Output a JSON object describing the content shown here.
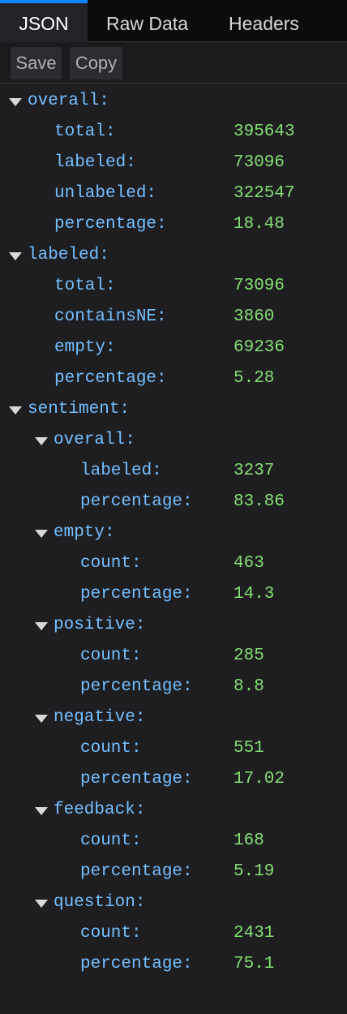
{
  "tabs": [
    {
      "label": "JSON",
      "active": true
    },
    {
      "label": "Raw Data",
      "active": false
    },
    {
      "label": "Headers",
      "active": false
    }
  ],
  "toolbar": {
    "save_label": "Save",
    "copy_label": "Copy"
  },
  "colors": {
    "key": "#75bfff",
    "value": "#86de74",
    "accent": "#0a84ff",
    "background": "#1e1e21"
  },
  "tree": {
    "overall": {
      "label": "overall:",
      "total": {
        "key": "total:",
        "value": "395643"
      },
      "labeled": {
        "key": "labeled:",
        "value": "73096"
      },
      "unlabeled": {
        "key": "unlabeled:",
        "value": "322547"
      },
      "percentage": {
        "key": "percentage:",
        "value": "18.48"
      }
    },
    "labeled": {
      "label": "labeled:",
      "total": {
        "key": "total:",
        "value": "73096"
      },
      "containsNE": {
        "key": "containsNE:",
        "value": "3860"
      },
      "empty": {
        "key": "empty:",
        "value": "69236"
      },
      "percentage": {
        "key": "percentage:",
        "value": "5.28"
      }
    },
    "sentiment": {
      "label": "sentiment:",
      "overall": {
        "label": "overall:",
        "labeled": {
          "key": "labeled:",
          "value": "3237"
        },
        "percentage": {
          "key": "percentage:",
          "value": "83.86"
        }
      },
      "empty": {
        "label": "empty:",
        "count": {
          "key": "count:",
          "value": "463"
        },
        "percentage": {
          "key": "percentage:",
          "value": "14.3"
        }
      },
      "positive": {
        "label": "positive:",
        "count": {
          "key": "count:",
          "value": "285"
        },
        "percentage": {
          "key": "percentage:",
          "value": "8.8"
        }
      },
      "negative": {
        "label": "negative:",
        "count": {
          "key": "count:",
          "value": "551"
        },
        "percentage": {
          "key": "percentage:",
          "value": "17.02"
        }
      },
      "feedback": {
        "label": "feedback:",
        "count": {
          "key": "count:",
          "value": "168"
        },
        "percentage": {
          "key": "percentage:",
          "value": "5.19"
        }
      },
      "question": {
        "label": "question:",
        "count": {
          "key": "count:",
          "value": "2431"
        },
        "percentage": {
          "key": "percentage:",
          "value": "75.1"
        }
      }
    }
  }
}
